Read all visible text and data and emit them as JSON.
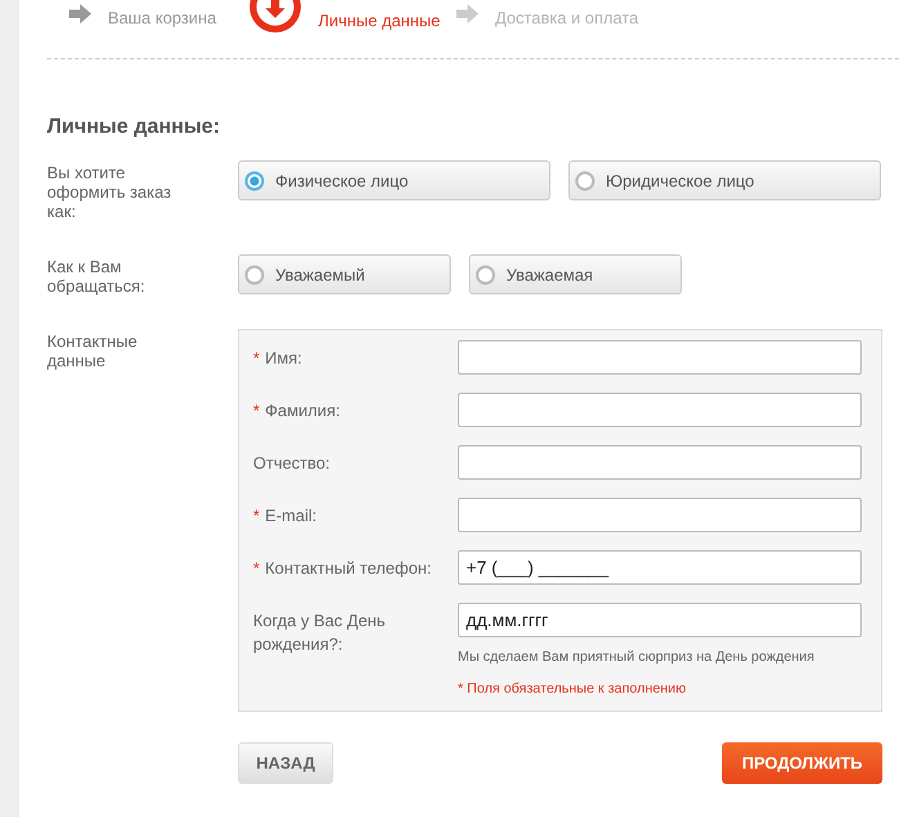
{
  "steps": [
    {
      "label": "Ваша корзина",
      "kind": "done"
    },
    {
      "label": "Личные данные",
      "kind": "current"
    },
    {
      "label": "Доставка и оплата",
      "kind": "todo"
    }
  ],
  "heading": "Личные данные:",
  "choice_rows": [
    {
      "label": "Вы хотите оформить заказ как:",
      "wide": true,
      "options": [
        {
          "label": "Физическое лицо",
          "selected": true
        },
        {
          "label": "Юридическое лицо",
          "selected": false
        }
      ]
    },
    {
      "label": "Как к Вам обращаться:",
      "wide": false,
      "options": [
        {
          "label": "Уважаемый",
          "selected": false
        },
        {
          "label": "Уважаемая",
          "selected": false
        }
      ]
    }
  ],
  "contacts": {
    "label": "Контактные данные",
    "fields": [
      {
        "required_mark": "*",
        "label": "Имя:"
      },
      {
        "required_mark": "*",
        "label": "Фамилия:"
      },
      {
        "label": "Отчество:"
      },
      {
        "required_mark": "*",
        "label": "E-mail:"
      },
      {
        "required_mark": "*",
        "label": "Контактный телефон:",
        "value": "+7 (___) _______"
      },
      {
        "label": "Когда у Вас День рождения?:",
        "value": "дд.мм.гггг",
        "hint": "Мы сделаем Вам приятный сюрприз на День рождения"
      }
    ],
    "required_note": "* Поля обязательные к заполнению"
  },
  "buttons": {
    "back": "НАЗАД",
    "next": "ПРОДОЛЖИТЬ"
  }
}
